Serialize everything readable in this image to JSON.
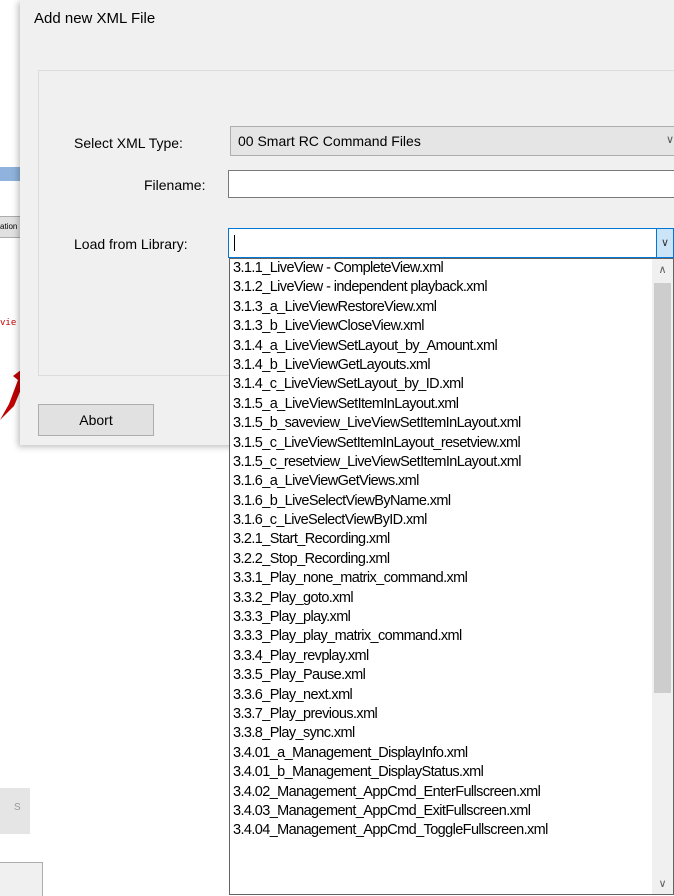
{
  "dialog": {
    "title": "Add new XML File",
    "xml_type_label": "Select XML Type:",
    "xml_type_value": "00 Smart RC Command Files",
    "filename_label": "Filename:",
    "filename_value": "",
    "library_label": "Load from Library:",
    "library_value": "",
    "abort_label": "Abort"
  },
  "background": {
    "button_fragment": "ation",
    "red_text_fragment": "vie",
    "status_fragment": "S"
  },
  "library": {
    "items": [
      "3.1.1_LiveView - CompleteView.xml",
      "3.1.2_LiveView - independent playback.xml",
      "3.1.3_a_LiveViewRestoreView.xml",
      "3.1.3_b_LiveViewCloseView.xml",
      "3.1.4_a_LiveViewSetLayout_by_Amount.xml",
      "3.1.4_b_LiveViewGetLayouts.xml",
      "3.1.4_c_LiveViewSetLayout_by_ID.xml",
      "3.1.5_a_LiveViewSetItemInLayout.xml",
      "3.1.5_b_saveview_LiveViewSetItemInLayout.xml",
      "3.1.5_c_LiveViewSetItemInLayout_resetview.xml",
      "3.1.5_c_resetview_LiveViewSetItemInLayout.xml",
      "3.1.6_a_LiveViewGetViews.xml",
      "3.1.6_b_LiveSelectViewByName.xml",
      "3.1.6_c_LiveSelectViewByID.xml",
      "3.2.1_Start_Recording.xml",
      "3.2.2_Stop_Recording.xml",
      "3.3.1_Play_none_matrix_command.xml",
      "3.3.2_Play_goto.xml",
      "3.3.3_Play_play.xml",
      "3.3.3_Play_play_matrix_command.xml",
      "3.3.4_Play_revplay.xml",
      "3.3.5_Play_Pause.xml",
      "3.3.6_Play_next.xml",
      "3.3.7_Play_previous.xml",
      "3.3.8_Play_sync.xml",
      "3.4.01_a_Management_DisplayInfo.xml",
      "3.4.01_b_Management_DisplayStatus.xml",
      "3.4.02_Management_AppCmd_EnterFullscreen.xml",
      "3.4.03_Management_AppCmd_ExitFullscreen.xml",
      "3.4.04_Management_AppCmd_ToggleFullscreen.xml"
    ]
  },
  "icons": {
    "dropdown_arrow": "chevron-down-icon",
    "scroll_up": "chevron-up-icon",
    "scroll_down": "chevron-down-icon"
  },
  "colors": {
    "focus_border": "#0078d7",
    "dialog_bg": "#f0f0f0",
    "arrow_red": "#c00000"
  }
}
